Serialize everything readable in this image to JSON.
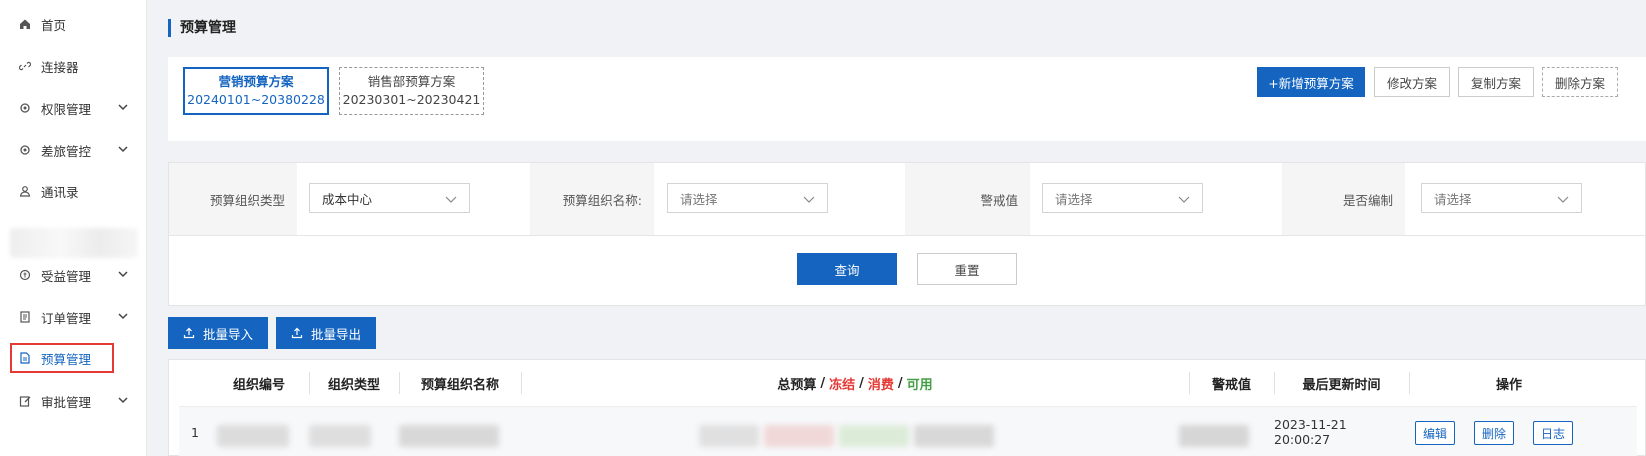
{
  "sidebar": {
    "items": [
      {
        "label": "首页",
        "icon": "home-icon"
      },
      {
        "label": "连接器",
        "icon": "link-icon"
      },
      {
        "label": "权限管理",
        "icon": "gear-icon"
      },
      {
        "label": "差旅管控",
        "icon": "gear-icon"
      },
      {
        "label": "通讯录",
        "icon": "user-icon"
      },
      {
        "label": "受益管理",
        "icon": "coin-icon"
      },
      {
        "label": "订单管理",
        "icon": "document-icon"
      },
      {
        "label": "预算管理",
        "icon": "document-icon"
      },
      {
        "label": "审批管理",
        "icon": "edit-icon"
      }
    ]
  },
  "page": {
    "title": "预算管理"
  },
  "plans": [
    {
      "name": "营销预算方案",
      "range": "20240101~20380228"
    },
    {
      "name": "销售部预算方案",
      "range": "20230301~20230421"
    }
  ],
  "actions": {
    "add": "+新增预算方案",
    "edit": "修改方案",
    "copy": "复制方案",
    "delete": "删除方案"
  },
  "filters": {
    "org_type_label": "预算组织类型",
    "org_type_value": "成本中心",
    "org_name_label": "预算组织名称:",
    "org_name_placeholder": "请选择",
    "warn_label": "警戒值",
    "warn_placeholder": "请选择",
    "compiled_label": "是否编制",
    "compiled_placeholder": "请选择",
    "query": "查询",
    "reset": "重置"
  },
  "bulk": {
    "import": "批量导入",
    "export": "批量导出"
  },
  "table": {
    "headers": {
      "org_code": "组织编号",
      "org_type": "组织类型",
      "org_name": "预算组织名称",
      "total": "总预算",
      "sep": "/",
      "frozen": "冻结",
      "spent": "消费",
      "available": "可用",
      "warn": "警戒值",
      "updated": "最后更新时间",
      "ops": "操作"
    },
    "rows": [
      {
        "index": "1",
        "updated": "2023-11-21 20:00:27",
        "ops": [
          "编辑",
          "删除",
          "日志"
        ]
      }
    ]
  }
}
